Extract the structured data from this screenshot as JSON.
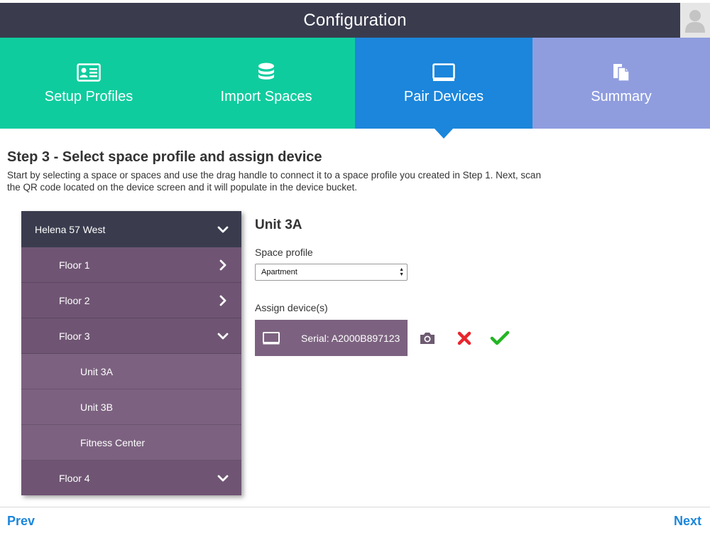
{
  "header": {
    "title": "Configuration"
  },
  "steps": [
    {
      "label": "Setup Profiles",
      "icon": "profile-card-icon",
      "color": "#0fcc9e"
    },
    {
      "label": "Import Spaces",
      "icon": "database-icon",
      "color": "#0fcc9e"
    },
    {
      "label": "Pair Devices",
      "icon": "monitor-icon",
      "color": "#1b86db",
      "active": true
    },
    {
      "label": "Summary",
      "icon": "documents-icon",
      "color": "#8f9ddf"
    }
  ],
  "page": {
    "heading": "Step 3 - Select space profile and assign device",
    "description": "Start by selecting a space or spaces and use the drag handle to connect it to a space profile you created in Step 1. Next, scan the QR code located on the device screen and it will populate in the device bucket."
  },
  "tree": {
    "building": {
      "label": "Helena 57 West",
      "icon": "chevron-down-icon"
    },
    "items": [
      {
        "label": "Floor 1",
        "level": "floor",
        "icon": "chevron-right-icon"
      },
      {
        "label": "Floor 2",
        "level": "floor",
        "icon": "chevron-right-icon"
      },
      {
        "label": "Floor 3",
        "level": "floor",
        "icon": "chevron-down-icon"
      },
      {
        "label": "Unit 3A",
        "level": "unit"
      },
      {
        "label": "Unit 3B",
        "level": "unit"
      },
      {
        "label": "Fitness Center",
        "level": "unit"
      },
      {
        "label": "Floor 4",
        "level": "floor",
        "icon": "chevron-down-icon"
      }
    ]
  },
  "detail": {
    "title": "Unit 3A",
    "space_profile_label": "Space profile",
    "space_profile_value": "Apartment",
    "assign_label": "Assign device(s)",
    "device_serial": "Serial: A2000B897123"
  },
  "footer": {
    "prev": "Prev",
    "next": "Next"
  },
  "colors": {
    "header": "#3a3c4e",
    "accent_blue": "#1b86db",
    "teal": "#0fcc9e",
    "lavender": "#8f9ddf",
    "purple": "#6f5573",
    "remove_red": "#e8262d",
    "confirm_green": "#23b523"
  }
}
